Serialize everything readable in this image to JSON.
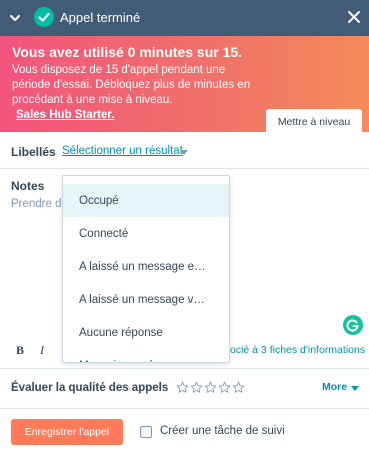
{
  "header": {
    "title": "Appel terminé",
    "collapse_icon": "chevron-down-icon",
    "status_icon": "check-circle-icon",
    "close_icon": "close-icon",
    "color": "#425b76"
  },
  "banner": {
    "title": "Vous avez utilisé 0 minutes sur 15.",
    "body": "Vous disposez de 15 d'appel pendant une période d'essai. Débloquez plus de minutes en procédant à une mise à niveau.",
    "link": "Sales Hub Starter.",
    "upgrade_button": "Mettre à niveau"
  },
  "labels": {
    "label": "Libellés",
    "select_text": "Sélectionner un résultat"
  },
  "dropdown": {
    "items": [
      "Occupé",
      "Connecté",
      "A laissé un message e…",
      "A laissé un message v…",
      "Aucune réponse",
      "Mauvais numéro"
    ],
    "selected_index": 0
  },
  "notes": {
    "label": "Notes",
    "placeholder": "Prendre des notes sur cet appel…"
  },
  "toolbar": {
    "bold": "B",
    "italic": "I",
    "association": "ocié à 3 fiches d'informations"
  },
  "rating": {
    "label": "Évaluer la qualité des appels",
    "max_stars": 5,
    "value": 0,
    "more": "More"
  },
  "footer": {
    "save_button": "Enregistrer l'appel",
    "task_label": "Créer une tâche de suivi",
    "task_checked": false
  },
  "colors": {
    "accent": "#0091ae",
    "primary_button": "#ff7a59",
    "success": "#00bda5"
  }
}
